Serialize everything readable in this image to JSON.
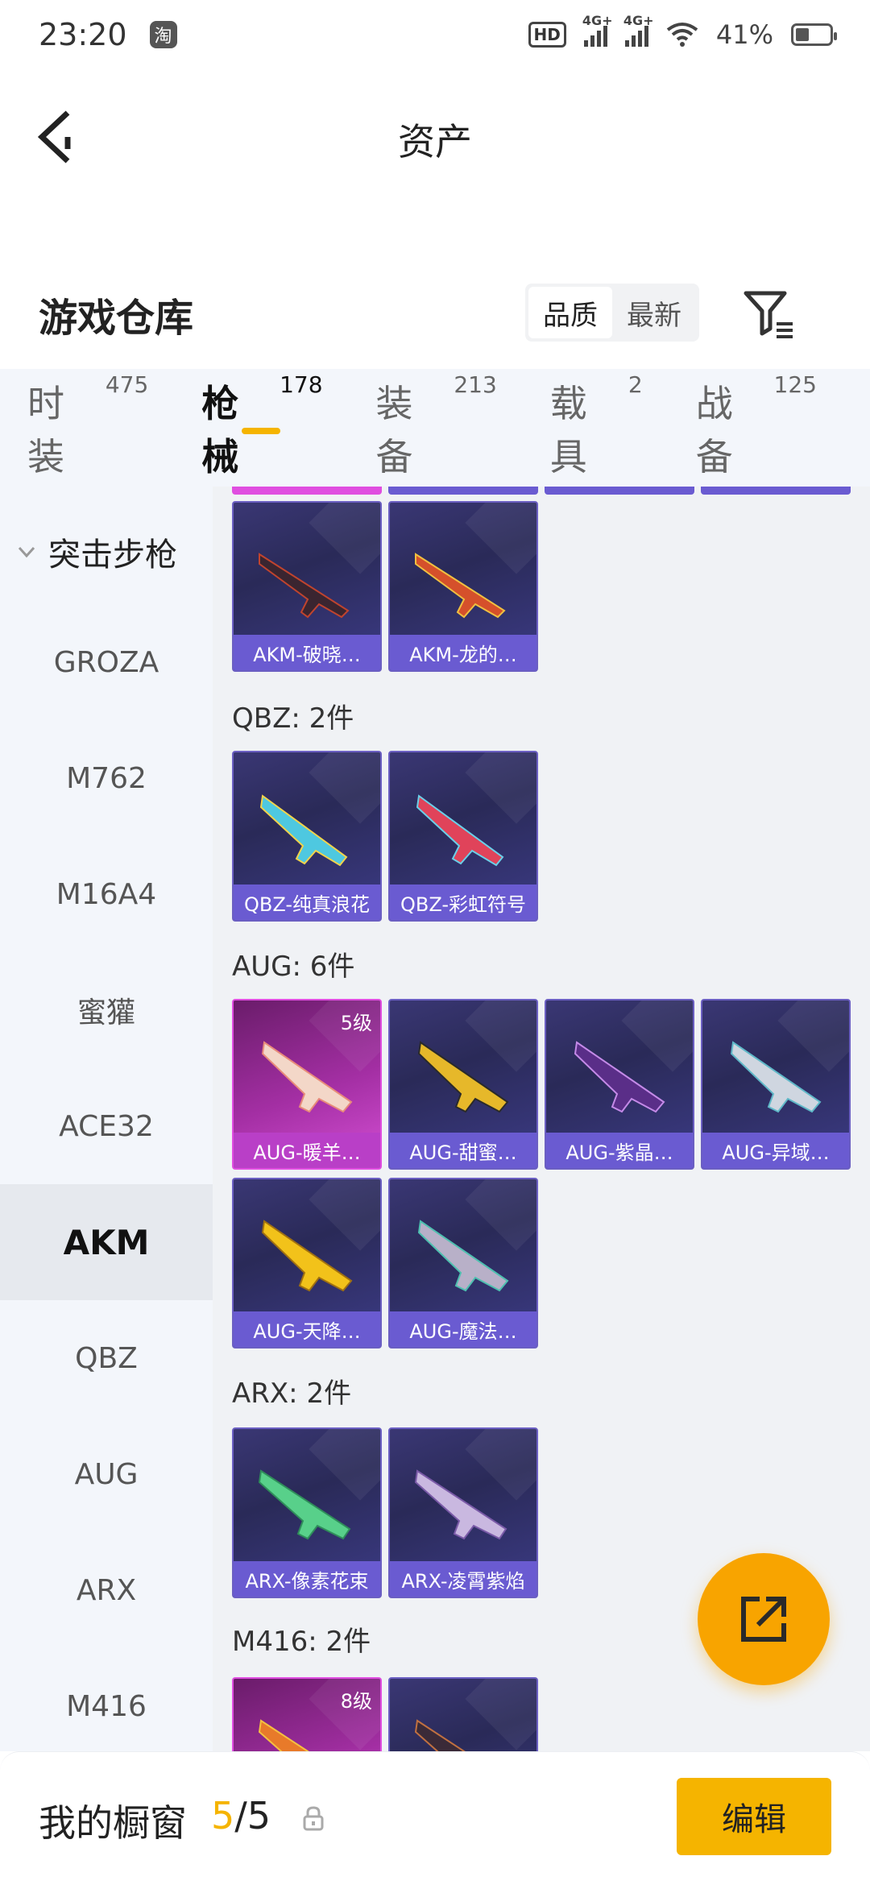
{
  "status": {
    "time": "23:20",
    "taobao": "淘",
    "hd": "HD",
    "net1": "4G+",
    "net2": "4G+",
    "battery": "41%"
  },
  "header": {
    "title": "资产"
  },
  "warehouse": {
    "title": "游戏仓库",
    "sort_options": [
      "品质",
      "最新"
    ]
  },
  "tabs": [
    {
      "label": "时装",
      "count": "475"
    },
    {
      "label": "枪械",
      "count": "178"
    },
    {
      "label": "装备",
      "count": "213"
    },
    {
      "label": "载具",
      "count": "2"
    },
    {
      "label": "战备",
      "count": "125"
    }
  ],
  "categories": {
    "header": "突击步枪",
    "items": [
      "GROZA",
      "M762",
      "M16A4",
      "蜜獾",
      "ACE32",
      "AKM",
      "QBZ",
      "AUG",
      "ARX",
      "M416"
    ]
  },
  "sections": {
    "akm": {
      "items": [
        {
          "name": "AKM-破晓…"
        },
        {
          "name": "AKM-龙的…"
        }
      ]
    },
    "qbz": {
      "title": "QBZ: 2件",
      "items": [
        {
          "name": "QBZ-纯真浪花"
        },
        {
          "name": "QBZ-彩虹符号"
        }
      ]
    },
    "aug": {
      "title": "AUG: 6件",
      "items": [
        {
          "name": "AUG-暖羊…",
          "level": "5级"
        },
        {
          "name": "AUG-甜蜜…"
        },
        {
          "name": "AUG-紫晶…"
        },
        {
          "name": "AUG-异域…"
        },
        {
          "name": "AUG-天降…"
        },
        {
          "name": "AUG-魔法…"
        }
      ]
    },
    "arx": {
      "title": "ARX: 2件",
      "items": [
        {
          "name": "ARX-像素花束"
        },
        {
          "name": "ARX-凌霄紫焰"
        }
      ]
    },
    "m416": {
      "title": "M416: 2件",
      "items": [
        {
          "level": "8级"
        },
        {}
      ]
    }
  },
  "bottom": {
    "label": "我的橱窗",
    "current": "5",
    "total": "/5",
    "edit": "编辑"
  },
  "colors": {
    "accent": "#f5b400",
    "fab": "#f8a400",
    "card_purple": "#6a5bd1",
    "card_pink": "#e04ee0"
  }
}
